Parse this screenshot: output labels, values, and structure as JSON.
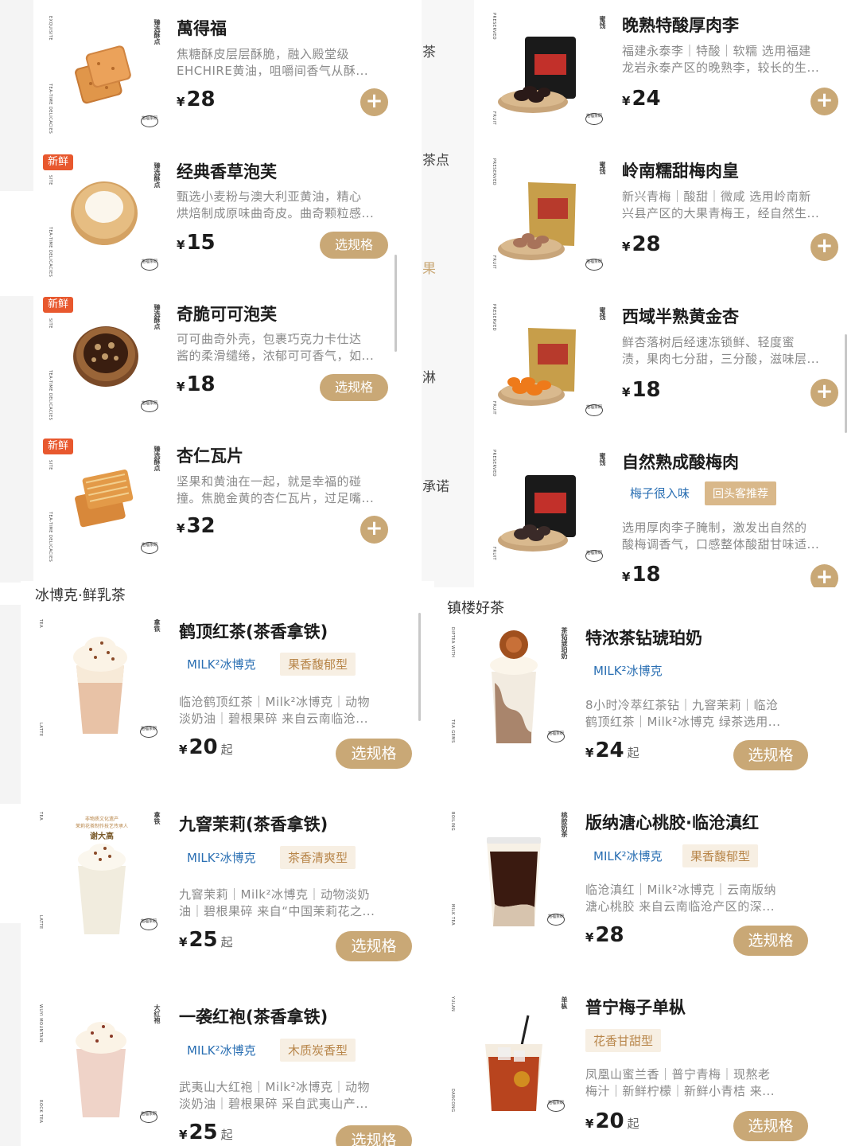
{
  "top_left": {
    "side_chars": [
      "茶",
      "茶点",
      "果",
      "淋",
      "承诺"
    ],
    "items": [
      {
        "name": "萬得福",
        "desc1": "焦糖酥皮层层酥脆，融入殿堂级",
        "desc2": "EHCHIRE黄油，咀嚼间香气从酥...",
        "price": "28",
        "currency": "¥",
        "badge": "",
        "action": "plus",
        "vtag": "臻选酥点",
        "vtext1": "EXQUISITE",
        "vtext2": "TEA-TIME DELICACIES"
      },
      {
        "name": "经典香草泡芙",
        "desc1": "甄选小麦粉与澳大利亚黄油，精心",
        "desc2": "烘焙制成原味曲奇皮。曲奇颗粒感...",
        "price": "15",
        "currency": "¥",
        "badge": "新鲜",
        "action": "选规格",
        "vtag": "臻选酥点",
        "vtext1": "SITE",
        "vtext2": "TEA-TIME DELICACIES"
      },
      {
        "name": "奇脆可可泡芙",
        "desc1": "可可曲奇外壳，包裹巧克力卡仕达",
        "desc2": "酱的柔滑缱绻，浓郁可可香气，如...",
        "price": "18",
        "currency": "¥",
        "badge": "新鲜",
        "action": "选规格",
        "vtag": "臻选酥点",
        "vtext1": "SITE",
        "vtext2": "TEA-TIME DELICACIES"
      },
      {
        "name": "杏仁瓦片",
        "desc1": "坚果和黄油在一起，就是幸福的碰",
        "desc2": "撞。焦脆金黄的杏仁瓦片，过足嘴...",
        "price": "32",
        "currency": "¥",
        "badge": "新鲜",
        "action": "plus",
        "vtag": "臻选酥点",
        "vtext1": "SITE",
        "vtext2": "TEA-TIME DELICACIES"
      }
    ]
  },
  "top_right": {
    "items": [
      {
        "name": "晚熟特酸厚肉李",
        "desc1": "福建永泰李｜特酸｜软糯 选用福建",
        "desc2": "龙岩永泰产区的晚熟李，较长的生...",
        "price": "24",
        "currency": "¥",
        "action": "plus",
        "vtag": "蜜饯",
        "vtext1": "PRESERVED",
        "vtext2": "FRUIT",
        "tags": []
      },
      {
        "name": "岭南糯甜梅肉皇",
        "desc1": "新兴青梅｜酸甜｜微咸 选用岭南新",
        "desc2": "兴县产区的大果青梅王，经自然生...",
        "price": "28",
        "currency": "¥",
        "action": "plus",
        "vtag": "蜜饯",
        "vtext1": "PRESERVED",
        "vtext2": "FRUIT",
        "tags": []
      },
      {
        "name": "西域半熟黄金杏",
        "desc1": "鲜杏落树后经速冻锁鲜、轻度蜜",
        "desc2": "渍，果肉七分甜，三分酸，滋味层...",
        "price": "18",
        "currency": "¥",
        "action": "plus",
        "vtag": "蜜饯",
        "vtext1": "PRESERVED",
        "vtext2": "FRUIT",
        "tags": []
      },
      {
        "name": "自然熟成酸梅肉",
        "desc1": "选用厚肉李子腌制，激发出自然的",
        "desc2": "酸梅调香气，口感整体酸甜甘味适...",
        "price": "18",
        "currency": "¥",
        "action": "plus",
        "vtag": "蜜饯",
        "vtext1": "PRESERVED",
        "vtext2": "FRUIT",
        "tags": [
          "梅子很入味",
          "回头客推荐"
        ]
      }
    ]
  },
  "bottom_left": {
    "section_title": "冰博克·鲜乳茶",
    "items": [
      {
        "name": "鹤顶红茶(茶香拿铁)",
        "tag1": "MILK²冰博克",
        "tag2": "果香馥郁型",
        "desc1": "临沧鹤顶红茶｜Milk²冰博克｜动物",
        "desc2": "淡奶油｜碧根果碎 来自云南临沧...",
        "price": "20",
        "currency": "¥",
        "from": "起",
        "action": "选规格",
        "vtag": "拿铁",
        "vtext1": "TEA",
        "vtext2": "LATTE"
      },
      {
        "name": "九窨茉莉(茶香拿铁)",
        "tag1": "MILK²冰博克",
        "tag2": "茶香清爽型",
        "desc1": "九窨茉莉｜Milk²冰博克｜动物淡奶",
        "desc2": "油｜碧根果碎 来自“中国茉莉花之...",
        "price": "25",
        "currency": "¥",
        "from": "起",
        "action": "选规格",
        "vtag": "拿铁",
        "vtext1": "TEA",
        "vtext2": "LATTE",
        "heritage_line1": "非物质文化遗产",
        "heritage_line2": "茉莉花茶制作技艺传承人",
        "heritage_name": "谢大高"
      },
      {
        "name": "一袭红袍(茶香拿铁)",
        "tag1": "MILK²冰博克",
        "tag2": "木质炭香型",
        "desc1": "武夷山大红袍｜Milk²冰博克｜动物",
        "desc2": "淡奶油｜碧根果碎 采自武夷山产...",
        "price": "25",
        "currency": "¥",
        "from": "起",
        "action": "选规格",
        "vtag": "大红袍",
        "vtext1": "WUYI MOUNTAIN",
        "vtext2": "ROCK TEA"
      }
    ]
  },
  "bottom_right": {
    "section_title": "镇楼好茶",
    "items": [
      {
        "name": "特浓茶钻琥珀奶",
        "tag1": "MILK²冰博克",
        "tag2": "",
        "desc1": "8小时冷萃红茶钻｜九窨茉莉｜临沧",
        "desc2": "鹤顶红茶｜Milk²冰博克 绿茶选用...",
        "price": "24",
        "currency": "¥",
        "from": "起",
        "action": "选规格",
        "vtag": "茶钻琥珀奶",
        "vtext1": "DIPTEA WITH",
        "vtext2": "TEA GEMS"
      },
      {
        "name": "版纳溏心桃胶·临沧滇红",
        "tag1": "MILK²冰博克",
        "tag2": "果香馥郁型",
        "desc1": "临沧滇红｜Milk²冰博克｜云南版纳",
        "desc2": "溏心桃胶 来自云南临沧产区的深...",
        "price": "28",
        "currency": "¥",
        "from": "",
        "action": "选规格",
        "vtag": "桃胶奶茶",
        "vtext1": "BOILING",
        "vtext2": "MILK TEA"
      },
      {
        "name": "普宁梅子单枞",
        "tag1": "",
        "tag2": "花香甘甜型",
        "desc1": "凤凰山蜜兰香｜普宁青梅｜现熬老",
        "desc2": "梅汁｜新鲜柠檬｜新鲜小青桔 来...",
        "price": "20",
        "currency": "¥",
        "from": "起",
        "action": "选规格",
        "vtag": "单枞",
        "vtext1": "YULAN",
        "vtext2": "DANCONG"
      }
    ]
  },
  "stamp_text": "抱福茶研",
  "colors": {
    "accent": "#c9a876",
    "new_badge": "#e8582e",
    "tag_blue": "#2a6fb3",
    "tag_gold": "#b8864a"
  }
}
